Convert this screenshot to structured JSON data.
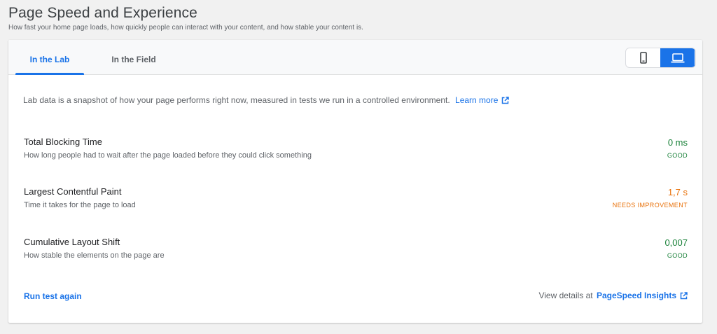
{
  "header": {
    "title": "Page Speed and Experience",
    "subtitle": "How fast your home page loads, how quickly people can interact with your content, and how stable your content is."
  },
  "tabs": [
    {
      "label": "In the Lab",
      "active": true
    },
    {
      "label": "In the Field",
      "active": false
    }
  ],
  "device_toggle": {
    "options": [
      {
        "icon": "mobile-icon",
        "active": false
      },
      {
        "icon": "desktop-icon",
        "active": true
      }
    ]
  },
  "intro": {
    "text": "Lab data is a snapshot of how your page performs right now, measured in tests we run in a controlled environment.",
    "link_label": "Learn more",
    "link_icon": "external-link-icon"
  },
  "metrics": [
    {
      "name": "Total Blocking Time",
      "description": "How long people had to wait after the page loaded before they could click something",
      "value": "0 ms",
      "status": "GOOD"
    },
    {
      "name": "Largest Contentful Paint",
      "description": "Time it takes for the page to load",
      "value": "1,7 s",
      "status": "NEEDS IMPROVEMENT"
    },
    {
      "name": "Cumulative Layout Shift",
      "description": "How stable the elements on the page are",
      "value": "0,007",
      "status": "GOOD"
    }
  ],
  "footer": {
    "run_again_label": "Run test again",
    "details_prefix": "View details at",
    "details_link_label": "PageSpeed Insights",
    "details_link_icon": "external-link-icon"
  },
  "colors": {
    "accent": "#1a73e8",
    "good": "#188038",
    "needs_improvement": "#e8710a"
  }
}
